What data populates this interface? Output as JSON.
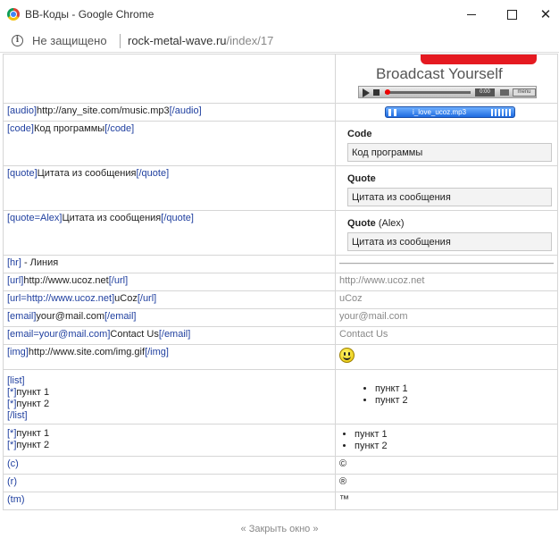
{
  "window": {
    "title": "BB-Коды - Google Chrome",
    "close_glyph": "✕"
  },
  "address_bar": {
    "security_icon": "info-icon",
    "security_label": "Не защищено",
    "host": "rock-metal-wave.ru",
    "path": "/index/17"
  },
  "video_preview": {
    "caption": "Broadcast Yourself",
    "time": "0:00",
    "menu": "menu"
  },
  "audio_player": {
    "filename": "i_love_ucoz.mp3"
  },
  "rows": {
    "audio": {
      "open": "[audio]",
      "body": "http://any_site.com/music.mp3",
      "close": "[/audio]"
    },
    "code": {
      "open": "[code]",
      "body": "Код программы",
      "close": "[/code]",
      "title": "Code",
      "content": "Код программы"
    },
    "quote": {
      "open": "[quote]",
      "body": "Цитата из сообщения",
      "close": "[/quote]",
      "title": "Quote",
      "content": "Цитата из сообщения"
    },
    "quote_author": {
      "open": "[quote=Alex]",
      "body": "Цитата из сообщения",
      "close": "[/quote]",
      "title": "Quote",
      "author": "(Alex)",
      "content": "Цитата из сообщения"
    },
    "hr": {
      "open": "[hr]",
      "body": " - Линия"
    },
    "url": {
      "open": "[url]",
      "body": "http://www.ucoz.net",
      "close": "[/url]",
      "result": "http://www.ucoz.net"
    },
    "url_named": {
      "open": "[url=http://www.ucoz.net]",
      "body": "uCoz",
      "close": "[/url]",
      "result": "uCoz"
    },
    "email": {
      "open": "[email]",
      "body": "your@mail.com",
      "close": "[/email]",
      "result": "your@mail.com"
    },
    "email_named": {
      "open": "[email=your@mail.com]",
      "body": "Contact Us",
      "close": "[/email]",
      "result": "Contact Us"
    },
    "img": {
      "open": "[img]",
      "body": "http://www.site.com/img.gif",
      "close": "[/img]",
      "result_icon": "smiley-icon"
    },
    "list": {
      "open": "[list]",
      "bullet": "[*]",
      "item1": "пункт 1",
      "item2": "пункт 2",
      "close": "[/list]"
    },
    "plain_list": {
      "bullet": "[*]",
      "item1": "пункт 1",
      "item2": "пункт 2"
    },
    "copyright": {
      "code": "(c)",
      "result": "©"
    },
    "registered": {
      "code": "(r)",
      "result": "®"
    },
    "trademark": {
      "code": "(tm)",
      "result": "™"
    }
  },
  "footer": {
    "close_link": "« Закрыть окно »"
  }
}
